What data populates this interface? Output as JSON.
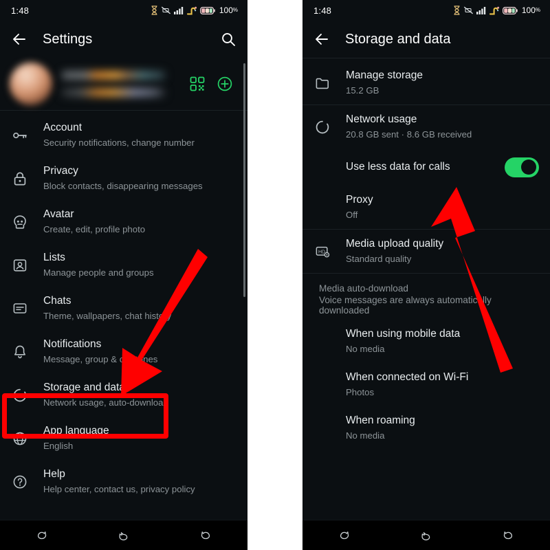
{
  "accent": {
    "green": "#25D366",
    "annotation_red": "#FF0000",
    "text_primary": "#E9EDEF",
    "text_secondary": "#8D9498",
    "background": "#0B0F12"
  },
  "left_phone": {
    "status_bar": {
      "clock": "1:48",
      "battery_text": "100",
      "battery_pct_symbol": "%",
      "icons": [
        "hourglass-icon",
        "vibrate-off-icon",
        "signal-bars-icon",
        "signal-alt-icon",
        "battery-icon"
      ]
    },
    "app_bar": {
      "back_icon": "back-arrow-icon",
      "title": "Settings",
      "search_icon": "search-icon"
    },
    "profile": {
      "avatar_name": "profile-avatar-blurred",
      "name_blurred": "",
      "status_blurred": "",
      "qr_icon": "qr-code-icon",
      "add_icon": "add-circle-icon"
    },
    "items": [
      {
        "icon": "key-icon",
        "title": "Account",
        "subtitle": "Security notifications, change number"
      },
      {
        "icon": "lock-icon",
        "title": "Privacy",
        "subtitle": "Block contacts, disappearing messages"
      },
      {
        "icon": "avatar-face-icon",
        "title": "Avatar",
        "subtitle": "Create, edit, profile photo"
      },
      {
        "icon": "contacts-card-icon",
        "title": "Lists",
        "subtitle": "Manage people and groups"
      },
      {
        "icon": "chat-bubble-icon",
        "title": "Chats",
        "subtitle": "Theme, wallpapers, chat history"
      },
      {
        "icon": "bell-icon",
        "title": "Notifications",
        "subtitle": "Message, group & call tones"
      },
      {
        "icon": "storage-loop-icon",
        "title": "Storage and data",
        "subtitle": "Network usage, auto-download"
      },
      {
        "icon": "globe-icon",
        "title": "App language",
        "subtitle": "English"
      },
      {
        "icon": "help-circle-icon",
        "title": "Help",
        "subtitle": "Help center, contact us, privacy policy"
      }
    ],
    "nav_bar": {
      "back_icon": "nav-back-duck-icon",
      "home_icon": "nav-home-duck-icon",
      "recents_icon": "nav-recents-duck-icon"
    }
  },
  "right_phone": {
    "status_bar": {
      "clock": "1:48",
      "battery_text": "100",
      "battery_pct_symbol": "%",
      "icons": [
        "hourglass-icon",
        "vibrate-off-icon",
        "signal-bars-icon",
        "signal-alt-icon",
        "battery-icon"
      ]
    },
    "app_bar": {
      "back_icon": "back-arrow-icon",
      "title": "Storage and data"
    },
    "items": [
      {
        "icon": "folder-icon",
        "title": "Manage storage",
        "subtitle": "15.2 GB"
      },
      {
        "icon": "storage-loop-icon",
        "title": "Network usage",
        "subtitle": "20.8 GB sent · 8.6 GB received"
      }
    ],
    "toggle_row": {
      "title": "Use less data for calls",
      "state": "on"
    },
    "proxy": {
      "title": "Proxy",
      "subtitle": "Off"
    },
    "media_quality": {
      "icon": "hd-settings-icon",
      "title": "Media upload quality",
      "subtitle": "Standard quality"
    },
    "auto_download": {
      "header": "Media auto-download",
      "header_sub": "Voice messages are always automatically downloaded",
      "options": [
        {
          "title": "When using mobile data",
          "subtitle": "No media"
        },
        {
          "title": "When connected on Wi-Fi",
          "subtitle": "Photos"
        },
        {
          "title": "When roaming",
          "subtitle": "No media"
        }
      ]
    },
    "nav_bar": {
      "back_icon": "nav-back-duck-icon",
      "home_icon": "nav-home-duck-icon",
      "recents_icon": "nav-recents-duck-icon"
    }
  },
  "annotations": {
    "highlight_box_target": "Storage and data",
    "left_arrow": "red-arrow-pointing-down-left",
    "right_arrow": "red-arrow-pointing-up-left"
  }
}
